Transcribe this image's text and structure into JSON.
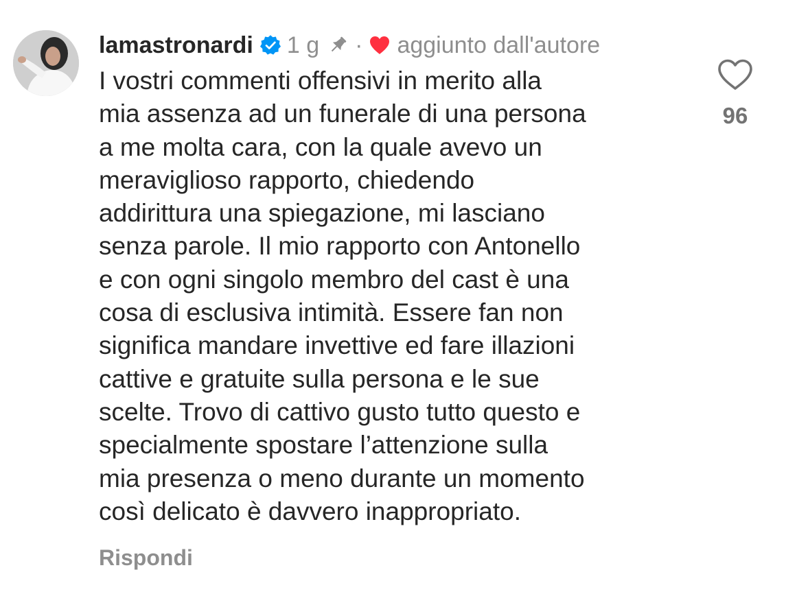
{
  "comment": {
    "username": "lamastronardi",
    "time": "1 g",
    "separator": "·",
    "added_label": "aggiunto dall'autore",
    "text": "I vostri commenti offensivi in merito alla\nmia assenza ad un funerale di una persona\na me molta cara, con la quale avevo un\nmeraviglioso rapporto, chiedendo\naddirittura una spiegazione, mi lasciano\nsenza parole. Il mio rapporto con Antonello\ne con ogni singolo membro del cast è una\ncosa di esclusiva intimità. Essere fan non\nsignifica mandare invettive ed fare illazioni\ncattive e  gratuite sulla persona e le sue\nscelte. Trovo di cattivo gusto tutto questo e\nspecialmente spostare l’attenzione sulla\nmia presenza o meno durante un momento\ncosì delicato è davvero inappropriato.",
    "reply_label": "Rispondi",
    "like_count": "96"
  },
  "icons": {
    "verified": "verified-badge-icon",
    "pin": "pin-icon",
    "author_heart": "heart-filled-icon",
    "like": "heart-outline-icon"
  },
  "colors": {
    "verified_blue": "#0095f6",
    "author_heart_red": "#ff3040",
    "secondary_text": "#8e8e8e",
    "primary_text": "#262626"
  }
}
